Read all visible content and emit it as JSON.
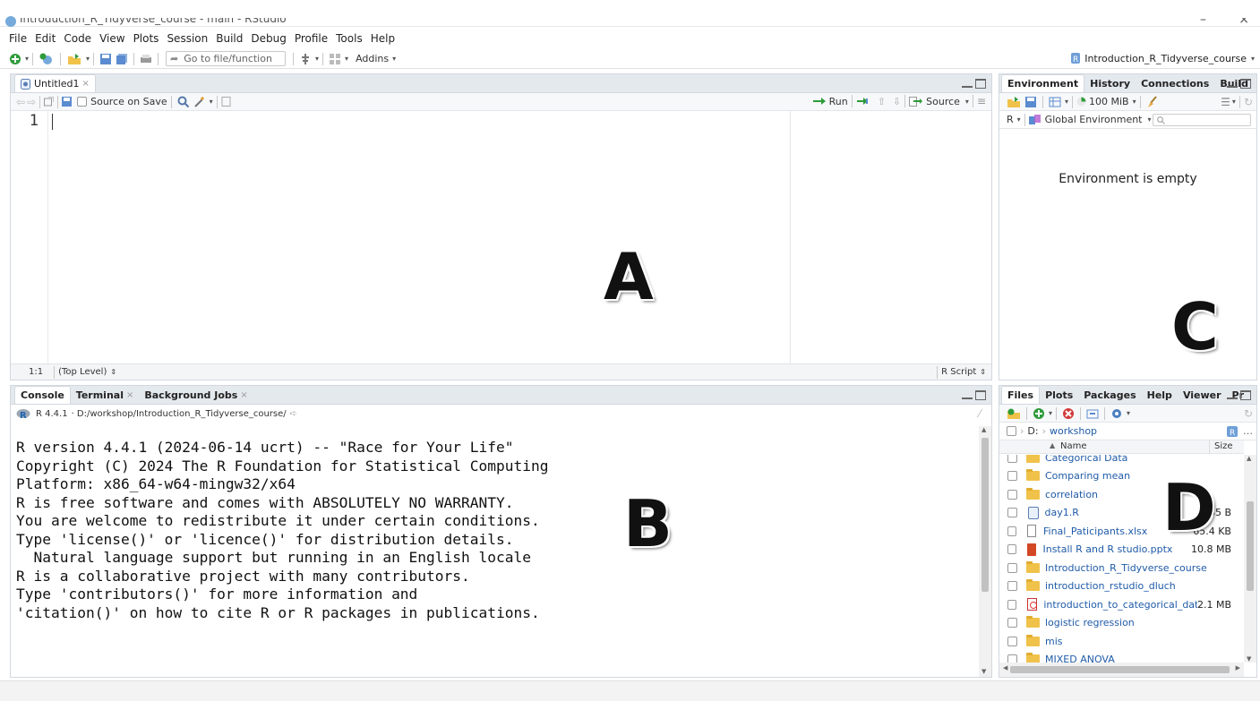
{
  "window": {
    "title": "Introduction_R_Tidyverse_course - main - RStudio"
  },
  "menu": [
    "File",
    "Edit",
    "Code",
    "View",
    "Plots",
    "Session",
    "Build",
    "Debug",
    "Profile",
    "Tools",
    "Help"
  ],
  "toolbar": {
    "goto_placeholder": "Go to file/function",
    "addins_label": "Addins",
    "project_label": "Introduction_R_Tidyverse_course"
  },
  "source_pane": {
    "tab_label": "Untitled1",
    "source_on_save": "Source on Save",
    "run_label": "Run",
    "source_label": "Source",
    "line_number": "1",
    "status_position": "1:1",
    "status_scope": "(Top Level)",
    "status_filetype": "R Script",
    "overlay_letter": "A"
  },
  "console_pane": {
    "tabs": [
      "Console",
      "Terminal",
      "Background Jobs"
    ],
    "r_version_label": "R 4.4.1",
    "working_dir": "· D:/workshop/Introduction_R_Tidyverse_course/",
    "lines": [
      "R version 4.4.1 (2024-06-14 ucrt) -- \"Race for Your Life\"",
      "Copyright (C) 2024 The R Foundation for Statistical Computing",
      "Platform: x86_64-w64-mingw32/x64",
      "",
      "R is free software and comes with ABSOLUTELY NO WARRANTY.",
      "You are welcome to redistribute it under certain conditions.",
      "Type 'license()' or 'licence()' for distribution details.",
      "",
      "  Natural language support but running in an English locale",
      "",
      "R is a collaborative project with many contributors.",
      "Type 'contributors()' for more information and",
      "'citation()' on how to cite R or R packages in publications."
    ],
    "overlay_letter": "B"
  },
  "env_pane": {
    "tabs": [
      "Environment",
      "History",
      "Connections",
      "Build"
    ],
    "memory_label": "100 MiB",
    "r_selector": "R",
    "scope_label": "Global Environment",
    "empty_message": "Environment is empty",
    "overlay_letter": "C"
  },
  "files_pane": {
    "tabs": [
      "Files",
      "Plots",
      "Packages",
      "Help",
      "Viewer",
      "Pr"
    ],
    "breadcrumb_drive": "D:",
    "breadcrumb_folder": "workshop",
    "col_name": "Name",
    "col_size": "Size",
    "files": [
      {
        "name": "Categorical Data",
        "type": "folder",
        "size": ""
      },
      {
        "name": "Comparing mean",
        "type": "folder",
        "size": ""
      },
      {
        "name": "correlation",
        "type": "folder",
        "size": ""
      },
      {
        "name": "day1.R",
        "type": "r",
        "size": "85 B"
      },
      {
        "name": "Final_Paticipants.xlsx",
        "type": "doc",
        "size": "65.4 KB"
      },
      {
        "name": "Install R and R studio.pptx",
        "type": "ppt",
        "size": "10.8 MB"
      },
      {
        "name": "Introduction_R_Tidyverse_course",
        "type": "folder",
        "size": ""
      },
      {
        "name": "introduction_rstudio_dluch",
        "type": "folder",
        "size": ""
      },
      {
        "name": "introduction_to_categorical_data_an...",
        "type": "pdf",
        "size": "2.1 MB"
      },
      {
        "name": "logistic regression",
        "type": "folder",
        "size": ""
      },
      {
        "name": "mis",
        "type": "folder",
        "size": ""
      },
      {
        "name": "MIXED ANOVA",
        "type": "folder",
        "size": ""
      }
    ],
    "overlay_letter": "D"
  },
  "colors": {
    "pane_header": "#e4e9ee",
    "link_blue": "#1f5ba8",
    "folder_yellow": "#f0c24a",
    "green_add": "#2e9b3a",
    "red_delete": "#d33b3b"
  }
}
